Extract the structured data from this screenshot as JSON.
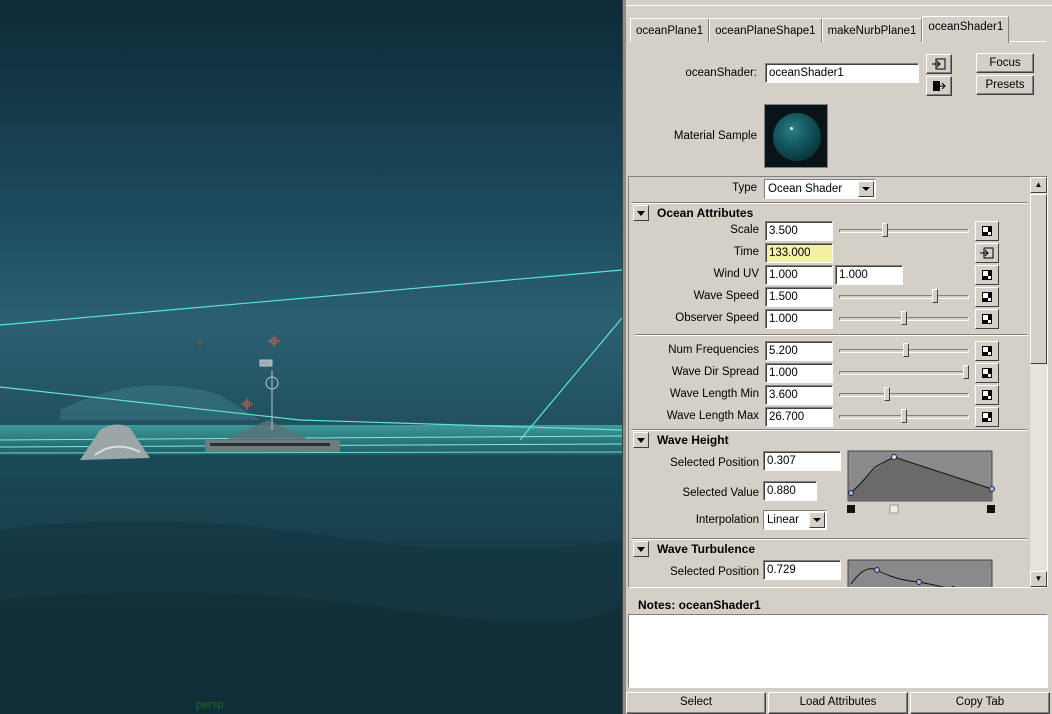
{
  "viewport": {
    "camera_label": "persp"
  },
  "editor": {
    "tabs": [
      "oceanPlane1",
      "oceanPlaneShape1",
      "makeNurbPlane1",
      "oceanShader1"
    ],
    "active_tab": "oceanShader1",
    "shader_label": "oceanShader:",
    "shader_name": "oceanShader1",
    "focus_label": "Focus",
    "presets_label": "Presets",
    "material_sample_label": "Material Sample",
    "type_label": "Type",
    "type_value": "Ocean Shader",
    "ocean_attributes": {
      "title": "Ocean Attributes",
      "scale": {
        "label": "Scale",
        "value": "3.500",
        "slider": 0.35
      },
      "time": {
        "label": "Time",
        "value": "133.000"
      },
      "wind_uv": {
        "label": "Wind UV",
        "u": "1.000",
        "v": "1.000"
      },
      "wave_speed": {
        "label": "Wave Speed",
        "value": "1.500",
        "slider": 0.75
      },
      "observer_speed": {
        "label": "Observer Speed",
        "value": "1.000",
        "slider": 0.5
      },
      "num_frequencies": {
        "label": "Num Frequencies",
        "value": "5.200",
        "slider": 0.52
      },
      "wave_dir_spread": {
        "label": "Wave Dir Spread",
        "value": "1.000",
        "slider": 1.0
      },
      "wave_length_min": {
        "label": "Wave Length Min",
        "value": "3.600",
        "slider": 0.36
      },
      "wave_length_max": {
        "label": "Wave Length Max",
        "value": "26.700",
        "slider": 0.5
      }
    },
    "wave_height": {
      "title": "Wave Height",
      "selected_position_label": "Selected Position",
      "selected_position": "0.307",
      "selected_value_label": "Selected Value",
      "selected_value": "0.880",
      "interpolation_label": "Interpolation",
      "interpolation": "Linear"
    },
    "wave_turbulence": {
      "title": "Wave Turbulence",
      "selected_position_label": "Selected Position",
      "selected_position": "0.729"
    },
    "notes_label": "Notes: oceanShader1",
    "notes_text": "",
    "buttons": {
      "select": "Select",
      "load_attributes": "Load Attributes",
      "copy_tab": "Copy Tab"
    }
  }
}
